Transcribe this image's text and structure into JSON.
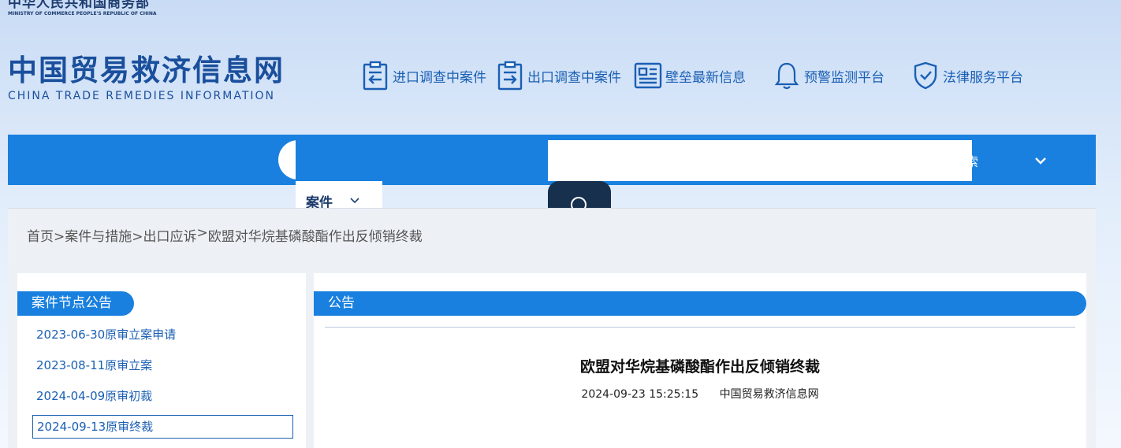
{
  "header": {
    "ministry_cn": "中华人民共和国商务部",
    "ministry_en": "MINISTRY OF COMMERCE PEOPLE'S REPUBLIC OF CHINA",
    "brand_cn": "中国贸易救济信息网",
    "brand_en": "CHINA TRADE REMEDIES INFORMATION"
  },
  "quick_nav": [
    {
      "label": "进口调查中案件",
      "icon": "import-case-icon"
    },
    {
      "label": "出口调查中案件",
      "icon": "export-case-icon"
    },
    {
      "label": "壁垒最新信息",
      "icon": "news-icon"
    },
    {
      "label": "预警监测平台",
      "icon": "bell-icon"
    },
    {
      "label": "法律服务平台",
      "icon": "shield-check-icon"
    }
  ],
  "navbar": {
    "search_text": "索",
    "case_select": "案件"
  },
  "breadcrumb": [
    "首页",
    " >案件与措施>",
    " 出口应诉 ",
    "> ",
    "欧盟对华烷基磷酸酯作出反倾销终裁"
  ],
  "left_panel": {
    "title": "案件节点公告",
    "items": [
      {
        "label": "2023-06-30原审立案申请",
        "active": false
      },
      {
        "label": "2023-08-11原审立案",
        "active": false
      },
      {
        "label": "2024-04-09原审初裁",
        "active": false
      },
      {
        "label": "2024-09-13原审终裁",
        "active": true
      }
    ]
  },
  "right_panel": {
    "title": "公告",
    "article_title": "欧盟对华烷基磷酸酯作出反倾销终裁",
    "date": "2024-09-23 15:25:15",
    "source": "中国贸易救济信息网"
  },
  "colors": {
    "primary_blue": "#1980df",
    "link_blue": "#1a5fb4",
    "dark_navy": "#16304e",
    "brand_blue": "#1a4f9c"
  }
}
